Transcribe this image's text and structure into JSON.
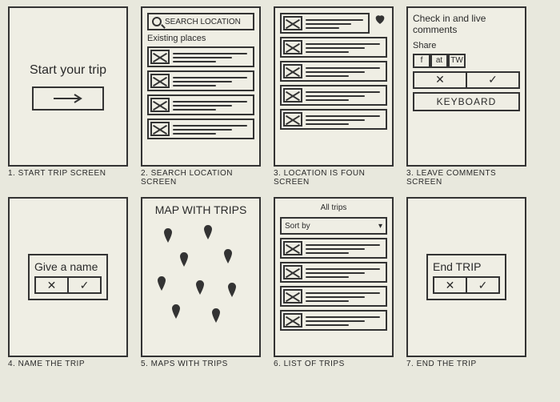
{
  "screens": {
    "s1": {
      "title": "Start your trip",
      "caption": "1. START TRIP SCREEN"
    },
    "s2": {
      "searchPlaceholder": "SEARCH LOCATION",
      "heading": "Existing places",
      "caption": "2. SEARCH LOCATION SCREEN"
    },
    "s3": {
      "caption": "3. LOCATION IS FOUN SCREEN"
    },
    "s4": {
      "heading": "Check in and live comments",
      "shareLabel": "Share",
      "social": [
        "f",
        "at",
        "TW"
      ],
      "cancel": "✕",
      "confirm": "✓",
      "keyboard": "KEYBOARD",
      "caption": "3. Leave comments SCREEN"
    },
    "s5": {
      "heading": "Give a name",
      "cancel": "✕",
      "confirm": "✓",
      "caption": "4. NAME THE TRIP"
    },
    "s6": {
      "heading": "MAP WITH TRIPS",
      "caption": "5. MAPS WITH TRIPS"
    },
    "s7": {
      "all": "All trips",
      "sort": "Sort by",
      "caption": "6. LIST OF TRIPS"
    },
    "s8": {
      "heading": "End TRIP",
      "cancel": "✕",
      "confirm": "✓",
      "caption": "7. END THE TRIP"
    }
  }
}
